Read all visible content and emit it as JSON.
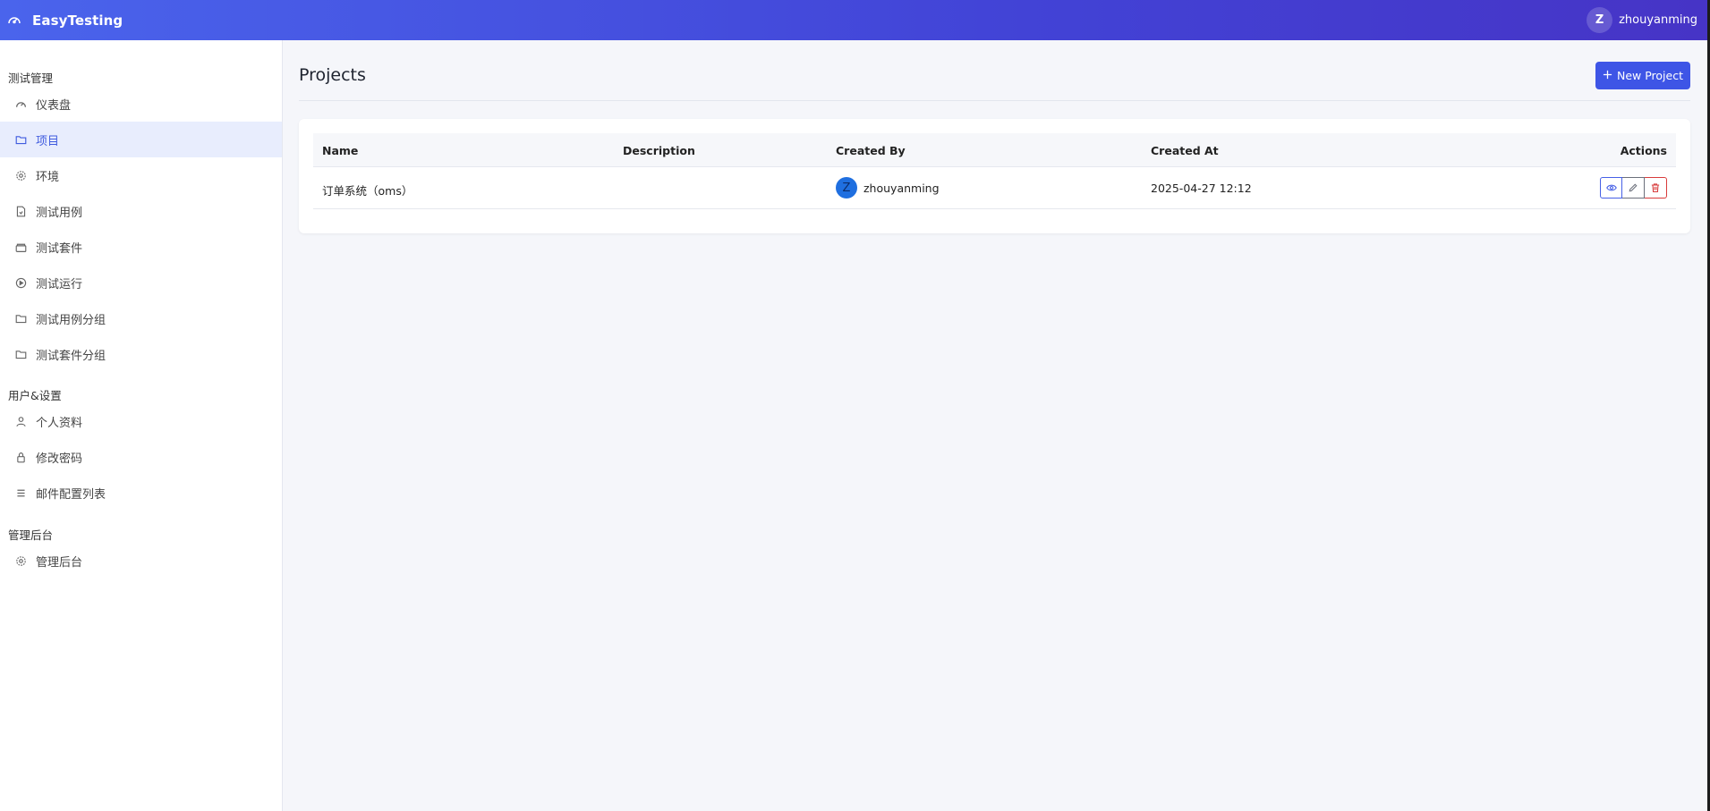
{
  "app": {
    "title": "EasyTesting",
    "logo_icon": "gauge-icon"
  },
  "user": {
    "initial": "Z",
    "name": "zhouyanming"
  },
  "sidebar": {
    "groups": [
      {
        "title": "测试管理",
        "items": [
          {
            "label": "仪表盘",
            "icon": "gauge-icon"
          },
          {
            "label": "项目",
            "icon": "folder-icon",
            "active": true
          },
          {
            "label": "环境",
            "icon": "gear-icon"
          },
          {
            "label": "测试用例",
            "icon": "file-icon"
          },
          {
            "label": "测试套件",
            "icon": "box-icon"
          },
          {
            "label": "测试运行",
            "icon": "play-circle-icon"
          },
          {
            "label": "测试用例分组",
            "icon": "folder-icon"
          },
          {
            "label": "测试套件分组",
            "icon": "folder-icon"
          }
        ]
      },
      {
        "title": "用户&设置",
        "items": [
          {
            "label": "个人资料",
            "icon": "user-icon"
          },
          {
            "label": "修改密码",
            "icon": "lock-icon"
          },
          {
            "label": "邮件配置列表",
            "icon": "list-icon"
          }
        ]
      },
      {
        "title": "管理后台",
        "items": [
          {
            "label": "管理后台",
            "icon": "gear-icon"
          }
        ]
      }
    ]
  },
  "main": {
    "title": "Projects",
    "new_button": "New Project",
    "table": {
      "columns": [
        "Name",
        "Description",
        "Created By",
        "Created At",
        "Actions"
      ],
      "rows": [
        {
          "name": "订单系统（oms）",
          "description": "",
          "creator_initial": "Z",
          "created_by": "zhouyanming",
          "created_at": "2025-04-27 12:12"
        }
      ]
    }
  },
  "colors": {
    "accent": "#3e55e6",
    "active_bg": "#e8edfd",
    "danger": "#d83b3b"
  }
}
